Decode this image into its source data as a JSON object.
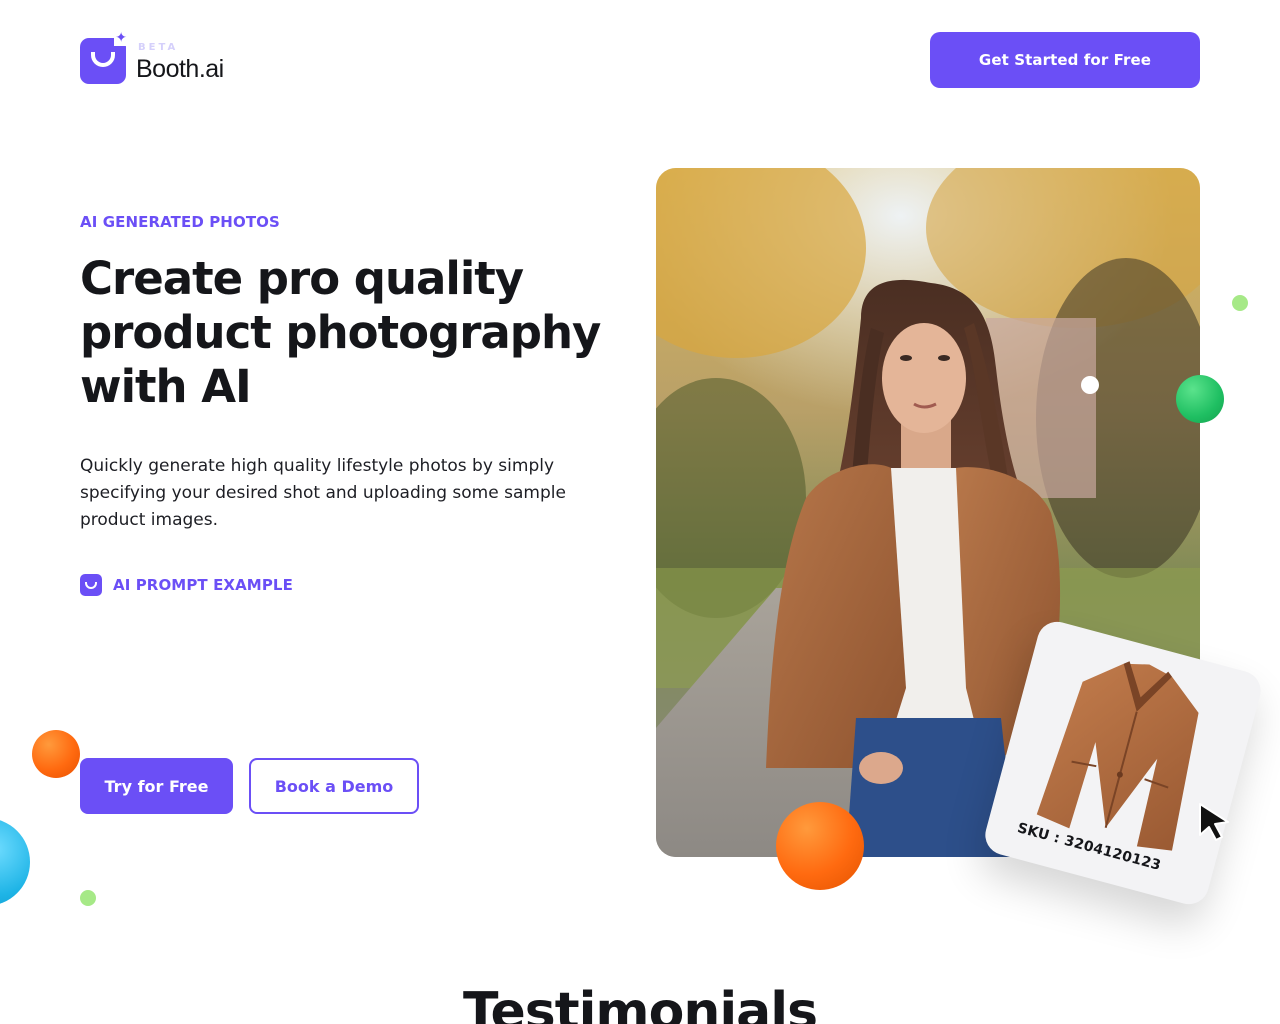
{
  "header": {
    "logo_badge": "BETA",
    "logo_name": "Booth.ai",
    "cta_label": "Get Started for Free"
  },
  "hero": {
    "eyebrow": "AI GENERATED PHOTOS",
    "headline": "Create pro quality product photography with AI",
    "subhead": "Quickly generate high quality lifestyle photos by simply specifying your desired shot and uploading some sample product images.",
    "prompt_example_label": "AI PROMPT EXAMPLE",
    "primary_button": "Try for Free",
    "secondary_button": "Book a Demo"
  },
  "product_card": {
    "sku": "SKU : 3204120123"
  },
  "testimonials": {
    "title": "Testimonials"
  },
  "colors": {
    "brand": "#6b4ff6",
    "text": "#15161a",
    "orange": "#ff6a10",
    "green": "#1fbf62",
    "lime": "#a6e987",
    "blue": "#1eb4e6"
  },
  "icons": [
    "logo-smile-icon",
    "sparkle-icon",
    "prompt-smile-icon",
    "cursor-arrow-icon"
  ]
}
